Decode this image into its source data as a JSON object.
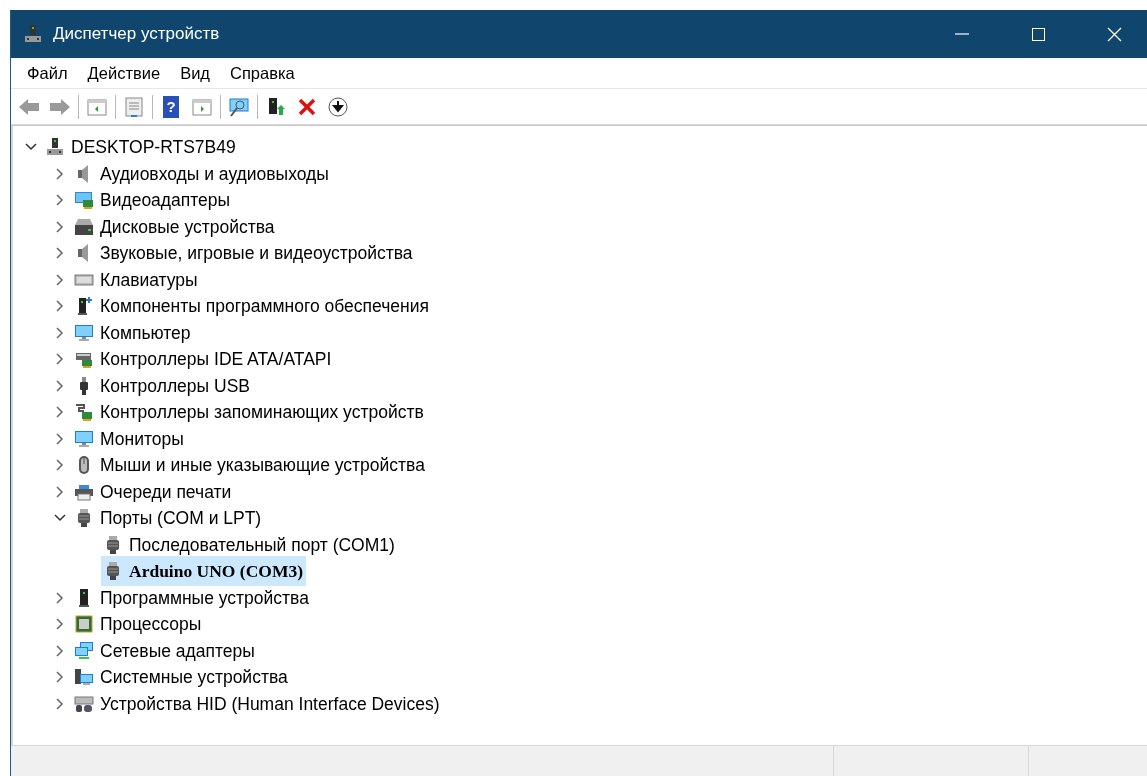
{
  "window": {
    "title": "Диспетчер устройств"
  },
  "menu": [
    "Файл",
    "Действие",
    "Вид",
    "Справка"
  ],
  "toolbar": [
    {
      "kind": "back"
    },
    {
      "kind": "forward"
    },
    {
      "kind": "separator"
    },
    {
      "kind": "tree"
    },
    {
      "kind": "separator"
    },
    {
      "kind": "properties"
    },
    {
      "kind": "separator"
    },
    {
      "kind": "help",
      "glyph": "?"
    },
    {
      "kind": "pane"
    },
    {
      "kind": "separator"
    },
    {
      "kind": "scan"
    },
    {
      "kind": "separator"
    },
    {
      "kind": "update"
    },
    {
      "kind": "remove"
    },
    {
      "kind": "disable"
    }
  ],
  "tree": [
    {
      "label": "DESKTOP-RTS7B49",
      "kind": "host",
      "expanded": true,
      "selected": false,
      "children": [
        {
          "label": "Аудиовходы и аудиовыходы",
          "kind": "speaker",
          "expanded": false,
          "selected": false
        },
        {
          "label": "Видеоадаптеры",
          "kind": "display",
          "expanded": false,
          "selected": false
        },
        {
          "label": "Дисковые устройства",
          "kind": "disk",
          "expanded": false,
          "selected": false
        },
        {
          "label": "Звуковые, игровые и видеоустройства",
          "kind": "speaker",
          "expanded": false,
          "selected": false
        },
        {
          "label": "Клавиатуры",
          "kind": "keyboard",
          "expanded": false,
          "selected": false
        },
        {
          "label": "Компоненты программного обеспечения",
          "kind": "component",
          "expanded": false,
          "selected": false
        },
        {
          "label": "Компьютер",
          "kind": "monitor",
          "expanded": false,
          "selected": false
        },
        {
          "label": "Контроллеры IDE ATA/ATAPI",
          "kind": "ide",
          "expanded": false,
          "selected": false
        },
        {
          "label": "Контроллеры USB",
          "kind": "usb",
          "expanded": false,
          "selected": false
        },
        {
          "label": "Контроллеры запоминающих устройств",
          "kind": "storage",
          "expanded": false,
          "selected": false
        },
        {
          "label": "Мониторы",
          "kind": "monitor",
          "expanded": false,
          "selected": false
        },
        {
          "label": "Мыши и иные указывающие устройства",
          "kind": "mouse",
          "expanded": false,
          "selected": false
        },
        {
          "label": "Очереди печати",
          "kind": "printer",
          "expanded": false,
          "selected": false
        },
        {
          "label": "Порты (COM и LPT)",
          "kind": "port",
          "expanded": true,
          "selected": false,
          "children": [
            {
              "label": "Последовательный порт (COM1)",
              "kind": "port",
              "selected": false
            },
            {
              "label": "Arduino UNO (COM3)",
              "kind": "port",
              "selected": true
            }
          ]
        },
        {
          "label": "Программные устройства",
          "kind": "firmware",
          "expanded": false,
          "selected": false
        },
        {
          "label": "Процессоры",
          "kind": "cpu",
          "expanded": false,
          "selected": false
        },
        {
          "label": "Сетевые адаптеры",
          "kind": "network",
          "expanded": false,
          "selected": false
        },
        {
          "label": "Системные устройства",
          "kind": "system",
          "expanded": false,
          "selected": false
        },
        {
          "label": "Устройства HID (Human Interface Devices)",
          "kind": "hid",
          "expanded": false,
          "selected": false
        }
      ]
    }
  ]
}
